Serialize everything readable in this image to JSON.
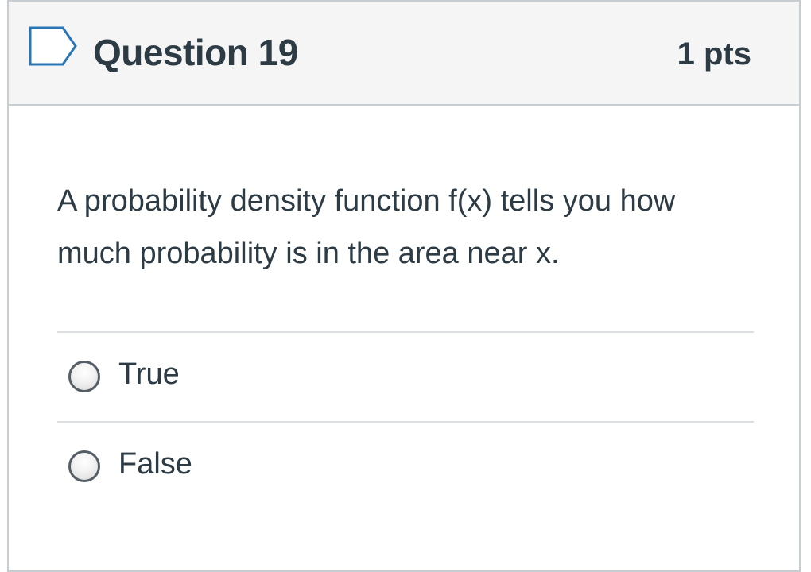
{
  "question": {
    "title": "Question 19",
    "points": "1 pts",
    "text": "A probability density function f(x) tells you how much probability is in the area near x.",
    "flag_icon": "bookmark-flag-icon"
  },
  "answers": [
    {
      "label": "True",
      "selected": false
    },
    {
      "label": "False",
      "selected": false
    }
  ],
  "colors": {
    "text": "#2d3b45",
    "header_bg": "#f5f5f5",
    "border": "#c7cdd1",
    "flag_stroke": "#2a76b5"
  }
}
